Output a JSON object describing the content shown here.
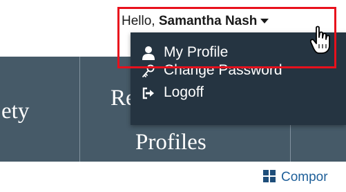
{
  "header": {
    "greeting_prefix": "Hello, ",
    "user_name": "Samantha Nash"
  },
  "user_menu": {
    "items": [
      {
        "label": "My Profile",
        "icon": "user-icon"
      },
      {
        "label": "Change Password",
        "icon": "key-icon"
      },
      {
        "label": "Logoff",
        "icon": "logout-icon"
      }
    ]
  },
  "nav": {
    "items": [
      {
        "label": "ety"
      },
      {
        "label_line1": "Re",
        "label_line2": "Profiles"
      }
    ]
  },
  "components_link": {
    "label": "Compor",
    "icon": "grid-icon"
  },
  "colors": {
    "nav_background": "#465a68",
    "menu_background": "#253441",
    "highlight": "#e8101c",
    "link": "#1e5f99"
  }
}
